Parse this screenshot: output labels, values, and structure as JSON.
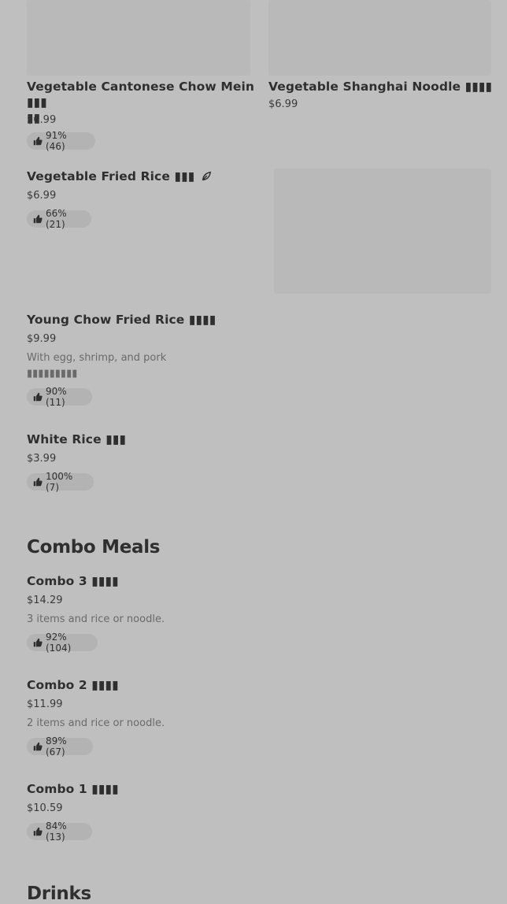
{
  "items": {
    "cantonese": {
      "name_line1": "Vegetable Cantonese Chow Mein ▮▮▮",
      "name_line2": "▮▮",
      "price": "$6.99",
      "rating": "91% (46)"
    },
    "shanghai": {
      "name": "Vegetable Shanghai Noodle ▮▮▮▮",
      "price": "$6.99"
    },
    "fried_rice": {
      "name": "Vegetable Fried Rice ▮▮▮",
      "price": "$6.99",
      "rating": "66% (21)",
      "badge_icon": "leaf-icon"
    },
    "young_chow": {
      "name": "Young Chow Fried Rice ▮▮▮▮",
      "price": "$9.99",
      "desc_line1": "With egg, shrimp, and pork",
      "desc_line2": "▮▮▮▮▮▮▮▮▮",
      "rating": "90% (11)"
    },
    "white_rice": {
      "name": "White Rice ▮▮▮",
      "price": "$3.99",
      "rating": "100% (7)"
    }
  },
  "sections": {
    "combo": "Combo Meals",
    "drinks": "Drinks"
  },
  "combos": [
    {
      "name": "Combo 3 ▮▮▮▮",
      "price": "$14.29",
      "desc": "3 items and rice or noodle.",
      "rating": "92% (104)"
    },
    {
      "name": "Combo 2 ▮▮▮▮",
      "price": "$11.99",
      "desc": "2 items and rice or noodle.",
      "rating": "89% (67)"
    },
    {
      "name": "Combo 1 ▮▮▮▮",
      "price": "$10.59",
      "rating": "84% (13)"
    }
  ],
  "icons": {
    "rating": "thumbs-up-icon"
  },
  "colors": {
    "background": "#bfbfbf",
    "image_placeholder": "#b9b9b9",
    "pill": "#b3b3b3"
  }
}
